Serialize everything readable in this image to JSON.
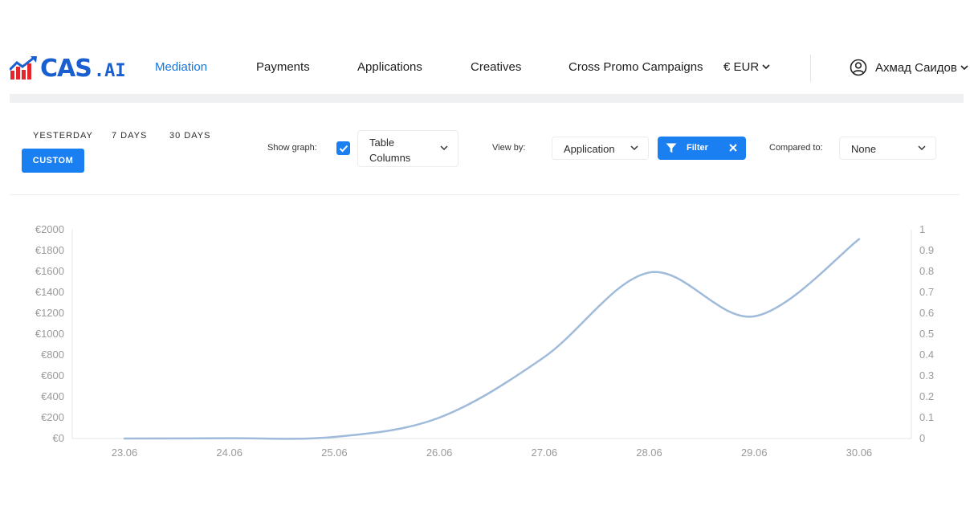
{
  "brand": {
    "name": "CAS",
    "suffix": ".AI",
    "color": "#1a5fd0",
    "accent": "#e2262c"
  },
  "nav": {
    "items": [
      {
        "label": "Mediation",
        "active": true
      },
      {
        "label": "Payments",
        "active": false
      },
      {
        "label": "Applications",
        "active": false
      },
      {
        "label": "Creatives",
        "active": false
      },
      {
        "label": "Cross Promo Campaigns",
        "active": false
      }
    ],
    "currency": "€ EUR",
    "user_name": "Ахмад Саидов"
  },
  "toolbar": {
    "periods": [
      "YESTERDAY",
      "7 DAYS",
      "30 DAYS"
    ],
    "custom_label": "CUSTOM",
    "show_graph_label": "Show graph:",
    "show_graph_checked": true,
    "table_columns": "Table\nColumns",
    "view_by_label": "View by:",
    "view_by_value": "Application",
    "filter_label": "Filter",
    "compared_to_label": "Compared to:",
    "compared_to_value": "None",
    "accent_color": "#1a7ff0"
  },
  "chart_data": {
    "type": "line",
    "x": [
      "23.06",
      "24.06",
      "25.06",
      "26.06",
      "27.06",
      "28.06",
      "29.06",
      "30.06"
    ],
    "series": [
      {
        "values": [
          0,
          3,
          15,
          200,
          780,
          1590,
          1170,
          1910
        ],
        "color": "#9fbbd9"
      }
    ],
    "y_left_ticks": [
      "€0",
      "€200",
      "€400",
      "€600",
      "€800",
      "€1000",
      "€1200",
      "€1400",
      "€1600",
      "€1800",
      "€2000"
    ],
    "y_right_ticks": [
      "0",
      "0.1",
      "0.2",
      "0.3",
      "0.4",
      "0.5",
      "0.6",
      "0.7",
      "0.8",
      "0.9",
      "1"
    ],
    "ylim": [
      0,
      2000
    ],
    "y2lim": [
      0,
      1
    ],
    "grid": false
  }
}
